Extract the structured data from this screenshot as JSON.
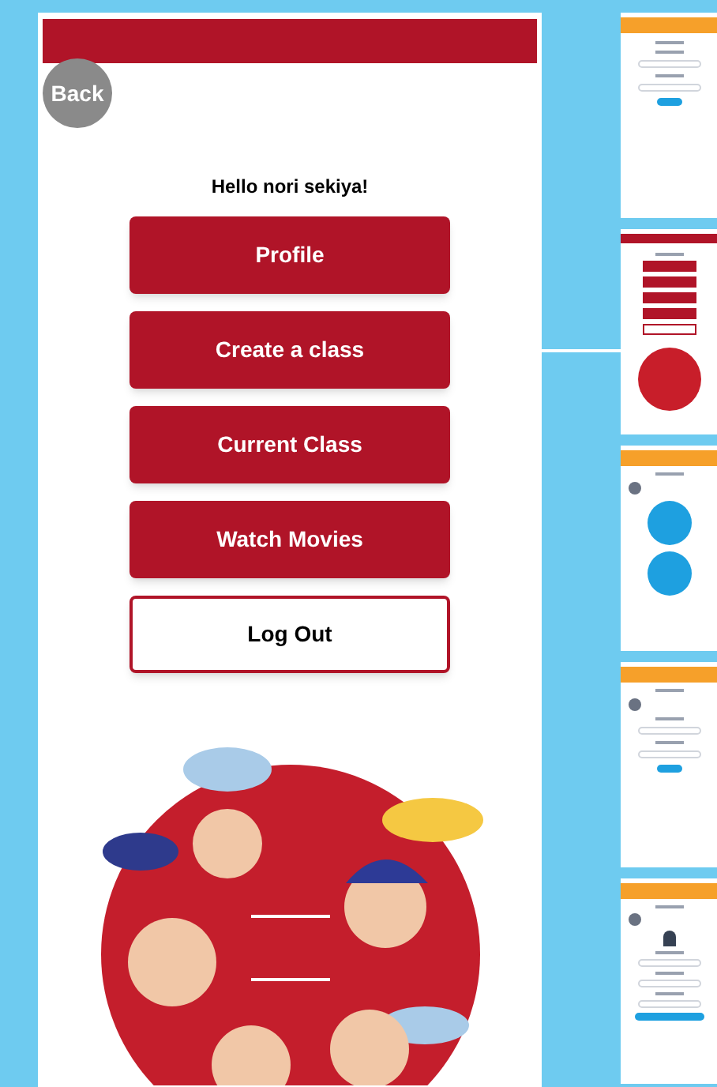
{
  "main_screen": {
    "back_button": "Back",
    "greeting": "Hello nori sekiya!",
    "buttons": [
      {
        "label": "Profile",
        "kind": "primary"
      },
      {
        "label": "Create a class",
        "kind": "primary"
      },
      {
        "label": "Current Class",
        "kind": "primary"
      },
      {
        "label": "Watch Movies",
        "kind": "primary"
      },
      {
        "label": "Log Out",
        "kind": "outline"
      }
    ]
  },
  "thumbnails": [
    {
      "kind": "login"
    },
    {
      "kind": "menu"
    },
    {
      "kind": "choices"
    },
    {
      "kind": "password"
    },
    {
      "kind": "profile"
    }
  ]
}
